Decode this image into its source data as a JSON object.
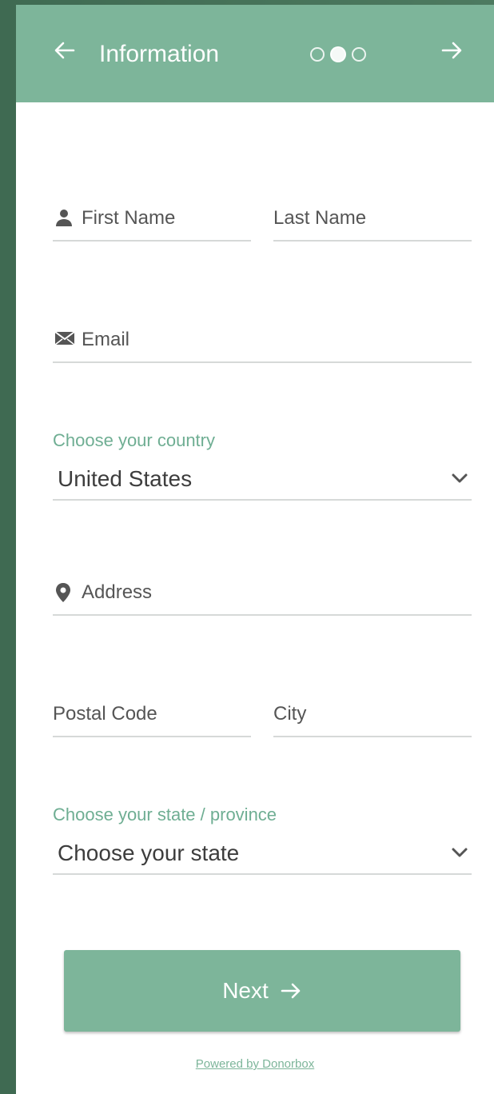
{
  "header": {
    "title": "Information",
    "steps_total": 3,
    "steps_active": 2,
    "back_icon": "arrow-left-icon",
    "next_icon": "arrow-right-icon",
    "color": "#7db59a"
  },
  "form": {
    "first_name_placeholder": "First Name",
    "last_name_placeholder": "Last Name",
    "email_placeholder": "Email",
    "country_label": "Choose your country",
    "country_value": "United States",
    "address_placeholder": "Address",
    "postal_code_placeholder": "Postal Code",
    "city_placeholder": "City",
    "state_label": "Choose your state / province",
    "state_value": "Choose your state"
  },
  "actions": {
    "next_label": "Next",
    "powered_by": "Powered by Donorbox"
  },
  "colors": {
    "accent": "#7db59a",
    "label_green": "#6fae93",
    "background": "#4a7459"
  }
}
